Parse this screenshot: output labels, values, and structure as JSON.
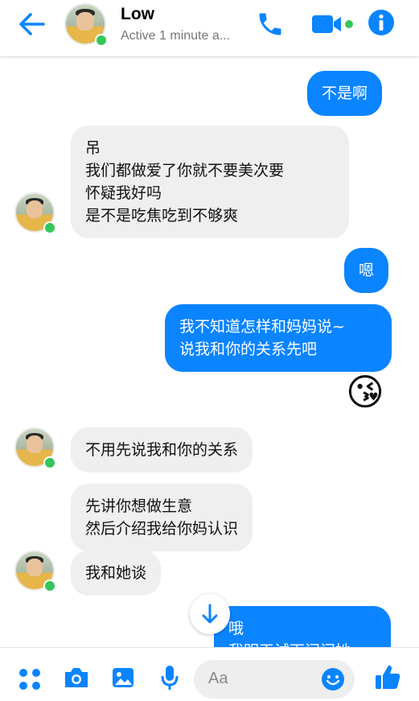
{
  "header": {
    "contact_name": "Low",
    "status": "Active 1 minute a..."
  },
  "messages": [
    {
      "side": "out",
      "text": "不是啊"
    },
    {
      "side": "in",
      "text": "吊\n我们都做爱了你就不要美次要\n怀疑我好吗\n是不是吃焦吃到不够爽"
    },
    {
      "side": "out",
      "text": "嗯"
    },
    {
      "side": "out",
      "text": "我不知道怎样和妈妈说~\n说我和你的关系先吧"
    },
    {
      "side": "out",
      "emoji": "😘"
    },
    {
      "side": "in",
      "text": "不用先说我和你的关系"
    },
    {
      "side": "in",
      "text": "先讲你想做生意\n然后介绍我给你妈认识"
    },
    {
      "side": "in",
      "text": "我和她谈"
    },
    {
      "side": "out",
      "text": "哦\n我明天试下问问她"
    }
  ],
  "composer": {
    "placeholder": "Aa"
  },
  "colors": {
    "accent": "#0a84ff",
    "incoming_bubble": "#efefef",
    "online": "#34c759"
  },
  "icons": {
    "header": [
      "back-arrow-icon",
      "phone-icon",
      "video-icon",
      "info-icon"
    ],
    "footer": [
      "apps-icon",
      "camera-icon",
      "image-icon",
      "mic-icon",
      "emoji-icon",
      "like-icon"
    ]
  }
}
